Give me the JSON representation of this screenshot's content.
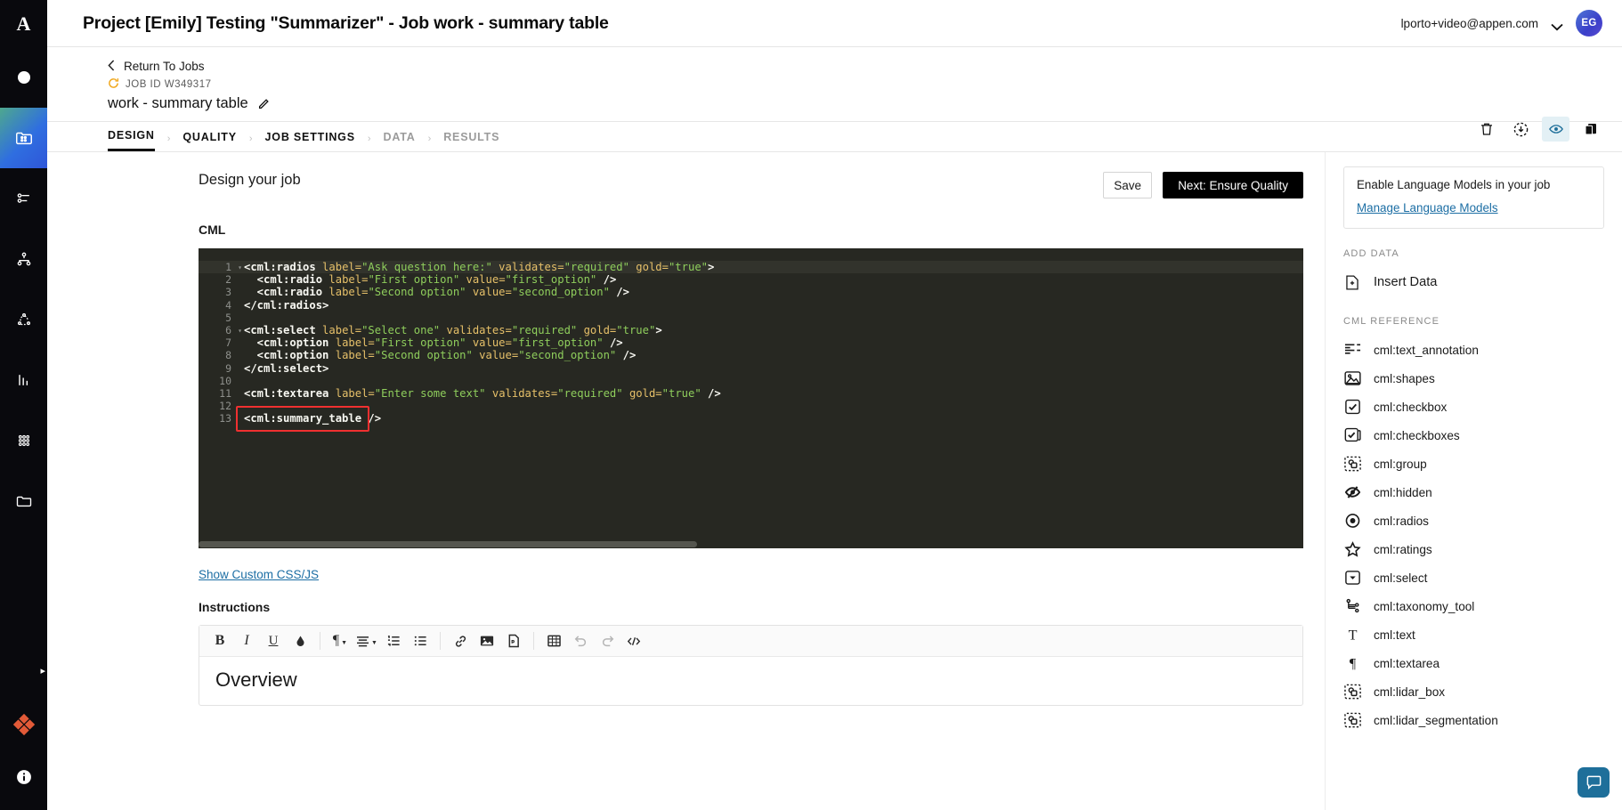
{
  "rail": {
    "logo": "A",
    "items": [
      {
        "name": "status-dot",
        "icon": "dot"
      },
      {
        "name": "jobs",
        "icon": "grid-folder",
        "active": true
      },
      {
        "name": "tasks",
        "icon": "sliders"
      },
      {
        "name": "workflow",
        "icon": "hierarchy"
      },
      {
        "name": "clusters",
        "icon": "nodes"
      },
      {
        "name": "analytics",
        "icon": "bar-chart"
      },
      {
        "name": "datasets",
        "icon": "dots-grid"
      },
      {
        "name": "files",
        "icon": "folder"
      }
    ],
    "diamond": "appen-mark",
    "expand_arrow": "▸",
    "info": "i"
  },
  "topbar": {
    "title": "Project [Emily] Testing \"Summarizer\" - Job work - summary table",
    "email": "lporto+video@appen.com",
    "avatar_initials": "EG"
  },
  "jobheader": {
    "return_label": "Return To Jobs",
    "job_id": "JOB ID W349317",
    "job_name": "work - summary table",
    "actions": [
      {
        "name": "delete-job",
        "icon": "trash"
      },
      {
        "name": "download-job",
        "icon": "download-circle"
      },
      {
        "name": "preview-job",
        "icon": "eye",
        "selected": true
      },
      {
        "name": "copy-job",
        "icon": "copy"
      }
    ]
  },
  "tabs": [
    {
      "label": "DESIGN",
      "state": "active"
    },
    {
      "label": "QUALITY",
      "state": "enabled"
    },
    {
      "label": "JOB SETTINGS",
      "state": "enabled"
    },
    {
      "label": "DATA",
      "state": "disabled"
    },
    {
      "label": "RESULTS",
      "state": "disabled"
    }
  ],
  "tab_separator": "›",
  "canvas": {
    "design_title": "Design your job",
    "save_label": "Save",
    "next_label": "Next: Ensure Quality",
    "cml_label": "CML",
    "custom_css_link": "Show Custom CSS/JS",
    "instructions_label": "Instructions",
    "instructions_heading": "Overview"
  },
  "code": {
    "lines": [
      {
        "n": "1",
        "fold": true,
        "highlighted": true,
        "tokens": [
          {
            "t": "<cml:radios",
            "c": "tag"
          },
          {
            "t": " label=",
            "c": "attr"
          },
          {
            "t": "\"Ask question here:\"",
            "c": "str"
          },
          {
            "t": " validates=",
            "c": "attr"
          },
          {
            "t": "\"required\"",
            "c": "str"
          },
          {
            "t": " gold=",
            "c": "attr"
          },
          {
            "t": "\"true\"",
            "c": "str"
          },
          {
            "t": ">",
            "c": "tag"
          }
        ]
      },
      {
        "n": "2",
        "tokens": [
          {
            "t": "  <cml:radio",
            "c": "tag"
          },
          {
            "t": " label=",
            "c": "attr"
          },
          {
            "t": "\"First option\"",
            "c": "str"
          },
          {
            "t": " value=",
            "c": "attr"
          },
          {
            "t": "\"first_option\"",
            "c": "str"
          },
          {
            "t": " />",
            "c": "tag"
          }
        ]
      },
      {
        "n": "3",
        "tokens": [
          {
            "t": "  <cml:radio",
            "c": "tag"
          },
          {
            "t": " label=",
            "c": "attr"
          },
          {
            "t": "\"Second option\"",
            "c": "str"
          },
          {
            "t": " value=",
            "c": "attr"
          },
          {
            "t": "\"second_option\"",
            "c": "str"
          },
          {
            "t": " />",
            "c": "tag"
          }
        ]
      },
      {
        "n": "4",
        "tokens": [
          {
            "t": "</cml:radios>",
            "c": "tag"
          }
        ]
      },
      {
        "n": "5",
        "tokens": []
      },
      {
        "n": "6",
        "fold": true,
        "tokens": [
          {
            "t": "<cml:select",
            "c": "tag"
          },
          {
            "t": " label=",
            "c": "attr"
          },
          {
            "t": "\"Select one\"",
            "c": "str"
          },
          {
            "t": " validates=",
            "c": "attr"
          },
          {
            "t": "\"required\"",
            "c": "str"
          },
          {
            "t": " gold=",
            "c": "attr"
          },
          {
            "t": "\"true\"",
            "c": "str"
          },
          {
            "t": ">",
            "c": "tag"
          }
        ]
      },
      {
        "n": "7",
        "tokens": [
          {
            "t": "  <cml:option",
            "c": "tag"
          },
          {
            "t": " label=",
            "c": "attr"
          },
          {
            "t": "\"First option\"",
            "c": "str"
          },
          {
            "t": " value=",
            "c": "attr"
          },
          {
            "t": "\"first_option\"",
            "c": "str"
          },
          {
            "t": " />",
            "c": "tag"
          }
        ]
      },
      {
        "n": "8",
        "tokens": [
          {
            "t": "  <cml:option",
            "c": "tag"
          },
          {
            "t": " label=",
            "c": "attr"
          },
          {
            "t": "\"Second option\"",
            "c": "str"
          },
          {
            "t": " value=",
            "c": "attr"
          },
          {
            "t": "\"second_option\"",
            "c": "str"
          },
          {
            "t": " />",
            "c": "tag"
          }
        ]
      },
      {
        "n": "9",
        "tokens": [
          {
            "t": "</cml:select>",
            "c": "tag"
          }
        ]
      },
      {
        "n": "10",
        "tokens": []
      },
      {
        "n": "11",
        "tokens": [
          {
            "t": "<cml:textarea",
            "c": "tag"
          },
          {
            "t": " label=",
            "c": "attr"
          },
          {
            "t": "\"Enter some text\"",
            "c": "str"
          },
          {
            "t": " validates=",
            "c": "attr"
          },
          {
            "t": "\"required\"",
            "c": "str"
          },
          {
            "t": " gold=",
            "c": "attr"
          },
          {
            "t": "\"true\"",
            "c": "str"
          },
          {
            "t": " />",
            "c": "tag"
          }
        ]
      },
      {
        "n": "12",
        "tokens": []
      },
      {
        "n": "13",
        "tokens": [
          {
            "t": "<cml:summary_table />",
            "c": "tag"
          }
        ]
      }
    ]
  },
  "rte_toolbar": [
    {
      "name": "bold",
      "glyph": "B",
      "style": "bold-serif"
    },
    {
      "name": "italic",
      "glyph": "I",
      "style": "italic-serif"
    },
    {
      "name": "underline",
      "glyph": "U",
      "style": "underline-serif"
    },
    {
      "name": "text-color",
      "glyph": "droplet"
    },
    {
      "sep": true
    },
    {
      "name": "paragraph-format",
      "glyph": "¶",
      "caret": true
    },
    {
      "name": "align",
      "glyph": "align",
      "caret": true
    },
    {
      "name": "ordered-list",
      "glyph": "ol"
    },
    {
      "name": "unordered-list",
      "glyph": "ul"
    },
    {
      "sep": true
    },
    {
      "name": "insert-link",
      "glyph": "link"
    },
    {
      "name": "insert-image",
      "glyph": "image"
    },
    {
      "name": "insert-file",
      "glyph": "file"
    },
    {
      "sep": true
    },
    {
      "name": "insert-table",
      "glyph": "table"
    },
    {
      "name": "undo",
      "glyph": "undo",
      "dim": true
    },
    {
      "name": "redo",
      "glyph": "redo",
      "dim": true
    },
    {
      "name": "code-view",
      "glyph": "code"
    }
  ],
  "right": {
    "lm_title": "Enable Language Models in your job",
    "lm_link": "Manage Language Models",
    "add_data_head": "ADD DATA",
    "insert_data": "Insert Data",
    "cml_ref_head": "CML REFERENCE",
    "cml_items": [
      {
        "label": "cml:text_annotation",
        "icon": "text-annotation"
      },
      {
        "label": "cml:shapes",
        "icon": "shapes"
      },
      {
        "label": "cml:checkbox",
        "icon": "checkbox"
      },
      {
        "label": "cml:checkboxes",
        "icon": "checkboxes"
      },
      {
        "label": "cml:group",
        "icon": "group"
      },
      {
        "label": "cml:hidden",
        "icon": "hidden"
      },
      {
        "label": "cml:radios",
        "icon": "radios"
      },
      {
        "label": "cml:ratings",
        "icon": "ratings"
      },
      {
        "label": "cml:select",
        "icon": "select"
      },
      {
        "label": "cml:taxonomy_tool",
        "icon": "taxonomy"
      },
      {
        "label": "cml:text",
        "icon": "text"
      },
      {
        "label": "cml:textarea",
        "icon": "textarea"
      },
      {
        "label": "cml:lidar_box",
        "icon": "lidar-box"
      },
      {
        "label": "cml:lidar_segmentation",
        "icon": "lidar-segmentation"
      }
    ]
  },
  "colors": {
    "accent_blue": "#1c6ea4",
    "editor_bg": "#272822",
    "highlight_red": "#f03030",
    "rail_bg": "#09090d",
    "job_id_amber": "#f0a81e"
  }
}
